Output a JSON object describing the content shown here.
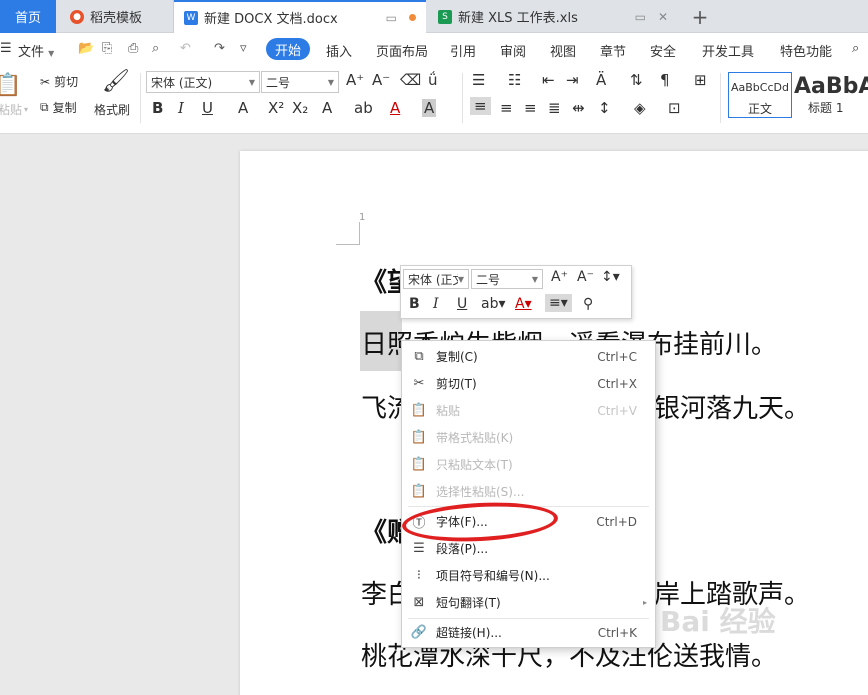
{
  "tabs": {
    "home": "首页",
    "template": "稻壳模板",
    "docx": "新建 DOCX 文档.docx",
    "xls": "新建 XLS 工作表.xls",
    "add": "+"
  },
  "menu": {
    "file": "文件",
    "start": "开始",
    "insert": "插入",
    "layout": "页面布局",
    "reference": "引用",
    "review": "审阅",
    "view": "视图",
    "chapter": "章节",
    "security": "安全",
    "devtools": "开发工具",
    "features": "特色功能"
  },
  "ribbon": {
    "paste": "粘贴",
    "cut": "剪切",
    "copy": "复制",
    "format_painter": "格式刷",
    "font_name": "宋体 (正文)",
    "font_size": "二号",
    "style_normal_preview": "AaBbCcDd",
    "style_normal": "正文",
    "style_h1_preview": "AaBbA",
    "style_h1": "标题 1"
  },
  "document": {
    "line_number": "1",
    "line1": "《望",
    "line2": "日照香炉生紫烟，遥看瀑布挂前川。",
    "line3": "飞流",
    "line3b": "银河落九天。",
    "line4": "《赠",
    "line5a": "李白",
    "line5b": "岸上踏歌声。",
    "line6": "桃花潭水深千尺，不及汪伦送我情。"
  },
  "mini_toolbar": {
    "font_name": "宋体 (正文",
    "font_size": "二号"
  },
  "context_menu": {
    "items": [
      {
        "label": "复制(C)",
        "key": "Ctrl+C"
      },
      {
        "label": "剪切(T)",
        "key": "Ctrl+X"
      },
      {
        "label": "粘贴",
        "key": "Ctrl+V"
      },
      {
        "label": "带格式粘贴(K)",
        "key": ""
      },
      {
        "label": "只粘贴文本(T)",
        "key": ""
      },
      {
        "label": "选择性粘贴(S)...",
        "key": ""
      },
      {
        "label": "字体(F)...",
        "key": "Ctrl+D"
      },
      {
        "label": "段落(P)...",
        "key": ""
      },
      {
        "label": "项目符号和编号(N)...",
        "key": ""
      },
      {
        "label": "短句翻译(T)",
        "key": ""
      },
      {
        "label": "超链接(H)...",
        "key": "Ctrl+K"
      }
    ]
  },
  "watermark": "Bai 经验",
  "colors": {
    "accent": "#2d7be5",
    "annotation": "#e02020"
  }
}
